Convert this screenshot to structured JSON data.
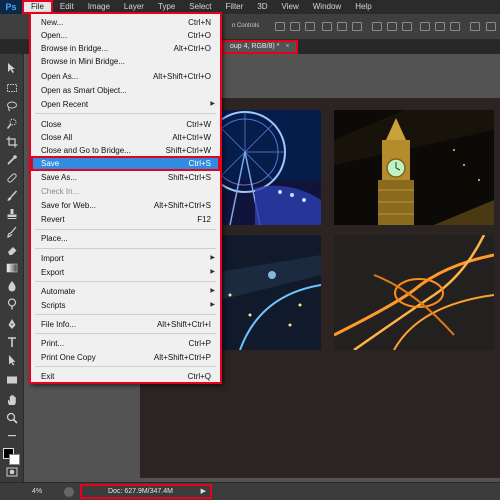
{
  "app": {
    "logo": "Ps",
    "menus": [
      "File",
      "Edit",
      "Image",
      "Layer",
      "Type",
      "Select",
      "Filter",
      "3D",
      "View",
      "Window",
      "Help"
    ]
  },
  "options_bar": {
    "show_controls_label": "Show Transform Controls",
    "visible_fragment": "n Controls"
  },
  "document_tab": {
    "label": "oup 4, RGB/8) *",
    "close": "×"
  },
  "file_menu": [
    {
      "label": "New...",
      "shortcut": "Ctrl+N"
    },
    {
      "label": "Open...",
      "shortcut": "Ctrl+O"
    },
    {
      "label": "Browse in Bridge...",
      "shortcut": "Alt+Ctrl+O"
    },
    {
      "label": "Browse in Mini Bridge...",
      "shortcut": ""
    },
    {
      "label": "Open As...",
      "shortcut": "Alt+Shift+Ctrl+O"
    },
    {
      "label": "Open as Smart Object...",
      "shortcut": ""
    },
    {
      "label": "Open Recent",
      "shortcut": ""
    },
    {
      "label": "Close",
      "shortcut": "Ctrl+W"
    },
    {
      "label": "Close All",
      "shortcut": "Alt+Ctrl+W"
    },
    {
      "label": "Close and Go to Bridge...",
      "shortcut": "Shift+Ctrl+W"
    },
    {
      "label": "Save",
      "shortcut": "Ctrl+S"
    },
    {
      "label": "Save As...",
      "shortcut": "Shift+Ctrl+S"
    },
    {
      "label": "Check In...",
      "shortcut": ""
    },
    {
      "label": "Save for Web...",
      "shortcut": "Alt+Shift+Ctrl+S"
    },
    {
      "label": "Revert",
      "shortcut": "F12"
    },
    {
      "label": "Place...",
      "shortcut": ""
    },
    {
      "label": "Import",
      "shortcut": ""
    },
    {
      "label": "Export",
      "shortcut": ""
    },
    {
      "label": "Automate",
      "shortcut": ""
    },
    {
      "label": "Scripts",
      "shortcut": ""
    },
    {
      "label": "File Info...",
      "shortcut": "Alt+Shift+Ctrl+I"
    },
    {
      "label": "Print...",
      "shortcut": "Ctrl+P"
    },
    {
      "label": "Print One Copy",
      "shortcut": "Alt+Shift+Ctrl+P"
    },
    {
      "label": "Exit",
      "shortcut": "Ctrl+Q"
    }
  ],
  "status": {
    "zoom": "4%",
    "doc_info": "Doc: 627.9M/347.4M",
    "arrow": "▶"
  },
  "colors": {
    "highlight_red": "#e8001c",
    "menu_selected": "#2f8ce0",
    "menu_bg": "#f0f0f0",
    "canvas_bg": "#2c2423"
  }
}
